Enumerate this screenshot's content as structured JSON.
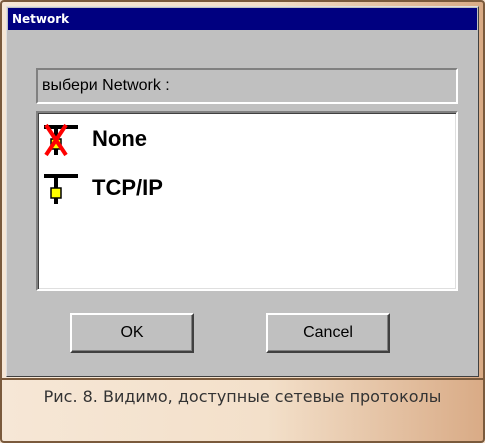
{
  "window": {
    "title": "Network"
  },
  "prompt": {
    "text": "выбери Network :"
  },
  "list": {
    "items": [
      {
        "label": "None",
        "icon": "network-adapter-disabled-icon"
      },
      {
        "label": "TCP/IP",
        "icon": "network-adapter-icon"
      }
    ]
  },
  "buttons": {
    "ok": "OK",
    "cancel": "Cancel"
  },
  "caption": {
    "text": "Рис. 8. Видимо, доступные сетевые протоколы"
  },
  "colors": {
    "titlebar": "#000080",
    "dialog_face": "#c0c0c0",
    "caption_bg": "#f3e0ca",
    "frame_border": "#7a5a3c"
  }
}
